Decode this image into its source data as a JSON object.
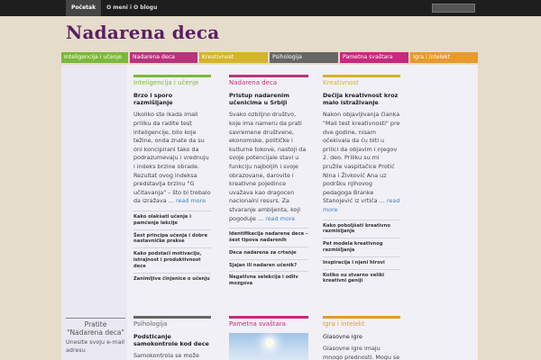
{
  "top_nav": [
    "Početak",
    "O meni i O blogu"
  ],
  "site_title": "Nadarena deca",
  "categories": [
    {
      "label": "Inteligencija i učenje",
      "color": "#7bb83a",
      "width": 74
    },
    {
      "label": "Nadarena deca",
      "color": "#b8347a",
      "width": 75
    },
    {
      "label": "Kreativnost",
      "color": "#d4b42a",
      "width": 76
    },
    {
      "label": "Psihologija",
      "color": "#666666",
      "width": 76
    },
    {
      "label": "Pametna svaštara",
      "color": "#c8287e",
      "width": 76
    },
    {
      "label": "Igra i intelekt",
      "color": "#e89a2a",
      "width": 75
    }
  ],
  "columns": [
    {
      "heading": "Inteligencija i učenje",
      "heading_color": "#7bb83a",
      "post_title": "Brzo i sporo razmišljanje",
      "excerpt": "Ukoliko ste ikada imali priliku da radite test inteligencije, bilo koje težine, onda znate da su oni koncipirani tako da podrazumevaju i vrednuju i indeks brzine obrade. Rezultat ovog indeksa predstavlja brzinu \"G učitavanja\" – što bi trebalo da izražava …",
      "read_more": "read more",
      "links": [
        "Kako olakšati učenje i pamćenje lekcije",
        "Šest principa učenja i dobre nastavničke prakse",
        "Kako podstaći motivaciju, istrajnost i produktivnost dece",
        "Zanimljive činjenice o učenju"
      ]
    },
    {
      "heading": "Nadarena deca",
      "heading_color": "#b8347a",
      "post_title": "Pristup nadarenim učenicima u Srbiji",
      "excerpt": "Svako ozbiljno društvo, koje ima nameru da prati savremene društvene, ekonomske, političke i kulturne tokove, nastoji da svoje potencijale stavi u funkciju najboljih i svoje obrazovane, darovite i kreativne pojedince uvažava kao dragocen nacionalni resurs. Za stvaranje ambijenta, koji pogoduje …",
      "read_more": "read more",
      "links": [
        "Identifikacija nadarene dece – šest tipova nadarenih",
        "Deca nadarena za crtanje",
        "Sjajan ili nadaren učenik?",
        "Negativna selekcija i odliv mozgova"
      ]
    },
    {
      "heading": "Kreativnost",
      "heading_color": "#d4b42a",
      "post_title": "Dečija kreativnost kroz malo istraživanje",
      "excerpt": "Nakon objavljivanja članka \"Mali test kreativnosti\" pre dve godine, nisam očekivala da ću biti u prilici da objavim i njegov 2. deo. Priliku su mi pružile vaspitačice Protić Nina i Živković Ana uz podršku njihovog pedagoga Branke Stanojević iz vrtića …",
      "read_more": "read more",
      "links": [
        "Kako pobolјšati kreativno razmišljanje",
        "Pet modela kreativnog razmišljanja",
        "Inspiracija i njeni hirovi",
        "Koliko su stvarno veliki kreativni geniji"
      ]
    }
  ],
  "sidebar": {
    "heading": "Pratite \"Nadarena deca\"",
    "text": "Unesite svoju e-mail adresu"
  },
  "lower_columns": [
    {
      "heading": "Psihologija",
      "heading_color": "#666666",
      "post_title": "Podsticanje samokontrole kod dece",
      "excerpt": "Samokontrola se može"
    },
    {
      "heading": "Pametna svaštara",
      "heading_color": "#c8287e"
    },
    {
      "heading": "Igra i intelekt",
      "heading_color": "#e89a2a",
      "post_title": "Glasovne igre",
      "excerpt": "Glasovne igre imaju mnogo prednosti. Mogu se"
    }
  ]
}
